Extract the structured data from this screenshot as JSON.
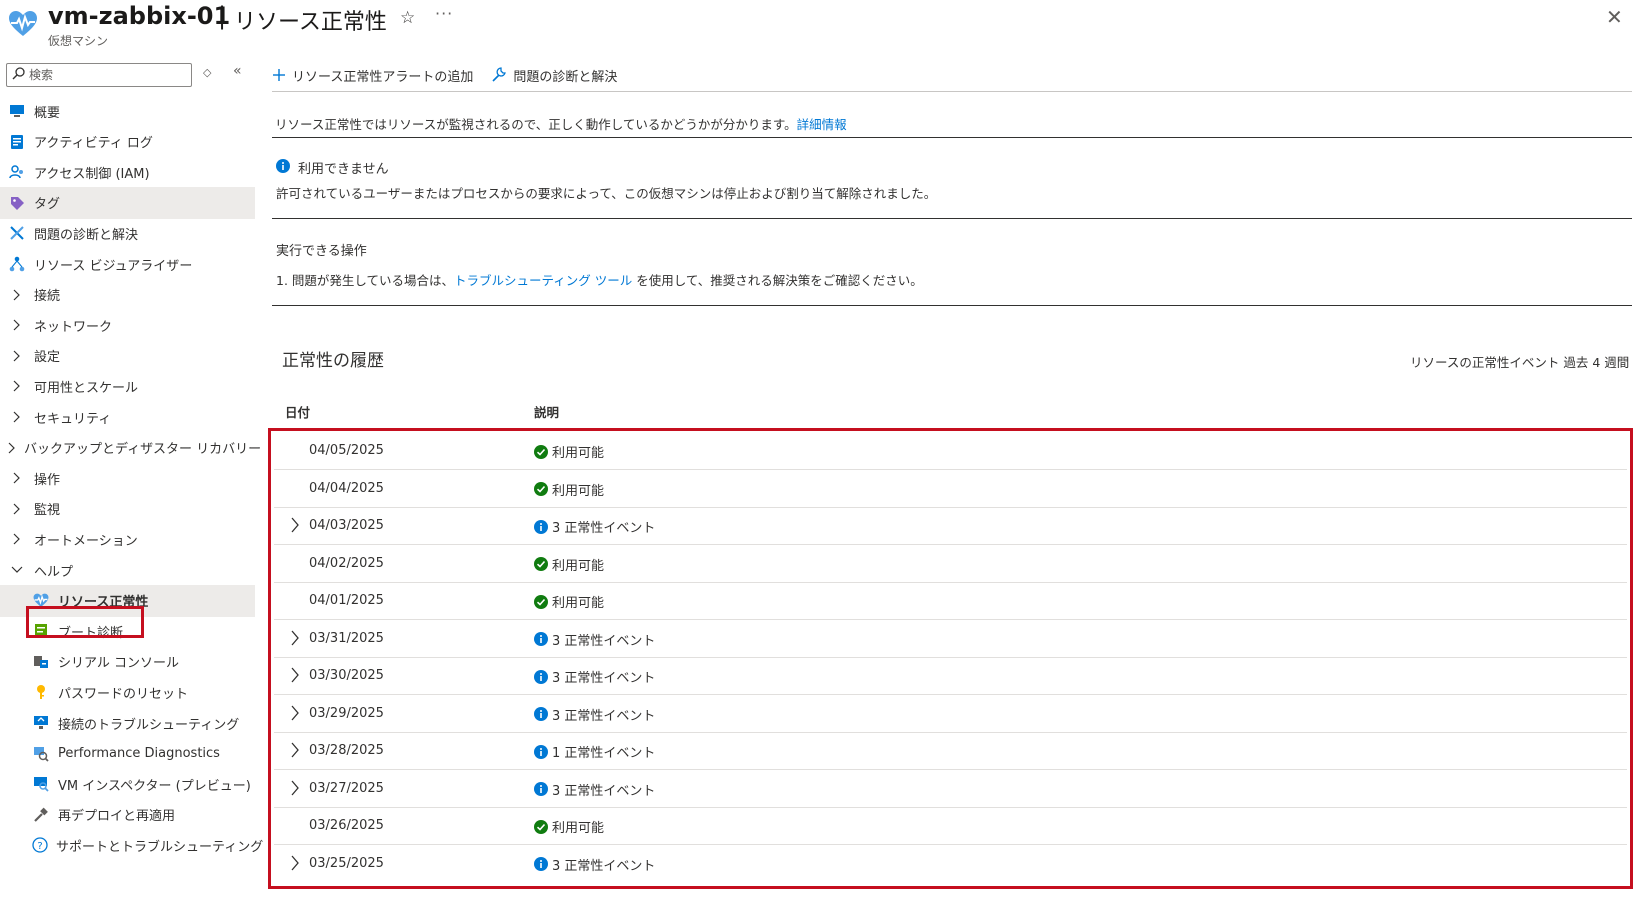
{
  "header": {
    "title": "vm-zabbix-01",
    "separator": "|",
    "page": "リソース正常性",
    "subtitle": "仮想マシン",
    "star": "☆",
    "more": "···",
    "close": "✕"
  },
  "sidebar": {
    "search_placeholder": "検索",
    "sort_glyph": "◇",
    "collapse_glyph": "«",
    "items": [
      {
        "label": "概要",
        "icon": "overview-icon",
        "level": 0,
        "type": "icon"
      },
      {
        "label": "アクティビティ ログ",
        "icon": "activity-log-icon",
        "level": 0,
        "type": "icon"
      },
      {
        "label": "アクセス制御 (IAM)",
        "icon": "iam-icon",
        "level": 0,
        "type": "icon"
      },
      {
        "label": "タグ",
        "icon": "tag-icon",
        "level": 0,
        "type": "icon",
        "selected": true
      },
      {
        "label": "問題の診断と解決",
        "icon": "diagnose-icon",
        "level": 0,
        "type": "icon"
      },
      {
        "label": "リソース ビジュアライザー",
        "icon": "visualizer-icon",
        "level": 0,
        "type": "icon"
      },
      {
        "label": "接続",
        "level": 0,
        "type": "collapsed"
      },
      {
        "label": "ネットワーク",
        "level": 0,
        "type": "collapsed"
      },
      {
        "label": "設定",
        "level": 0,
        "type": "collapsed"
      },
      {
        "label": "可用性とスケール",
        "level": 0,
        "type": "collapsed"
      },
      {
        "label": "セキュリティ",
        "level": 0,
        "type": "collapsed"
      },
      {
        "label": "バックアップとディザスター リカバリー",
        "level": 0,
        "type": "collapsed"
      },
      {
        "label": "操作",
        "level": 0,
        "type": "collapsed"
      },
      {
        "label": "監視",
        "level": 0,
        "type": "collapsed"
      },
      {
        "label": "オートメーション",
        "level": 0,
        "type": "collapsed"
      },
      {
        "label": "ヘルプ",
        "level": 0,
        "type": "expanded"
      },
      {
        "label": "リソース正常性",
        "icon": "resource-health-icon",
        "level": 1,
        "type": "icon",
        "selected": true,
        "active": true
      },
      {
        "label": "ブート診断",
        "icon": "boot-diagnostics-icon",
        "level": 1,
        "type": "icon"
      },
      {
        "label": "シリアル コンソール",
        "icon": "serial-console-icon",
        "level": 1,
        "type": "icon"
      },
      {
        "label": "パスワードのリセット",
        "icon": "key-icon",
        "level": 1,
        "type": "icon"
      },
      {
        "label": "接続のトラブルシューティング",
        "icon": "connection-troubleshoot-icon",
        "level": 1,
        "type": "icon"
      },
      {
        "label": "Performance Diagnostics",
        "icon": "performance-diagnostics-icon",
        "level": 1,
        "type": "icon"
      },
      {
        "label": "VM インスペクター (プレビュー)",
        "icon": "vm-inspector-icon",
        "level": 1,
        "type": "icon"
      },
      {
        "label": "再デプロイと再適用",
        "icon": "redeploy-icon",
        "level": 1,
        "type": "icon"
      },
      {
        "label": "サポートとトラブルシューティング",
        "icon": "help-circle-icon",
        "level": 1,
        "type": "icon"
      }
    ]
  },
  "toolbar": {
    "add_alert": "リソース正常性アラートの追加",
    "diagnose": "問題の診断と解決"
  },
  "intro": {
    "text": "リソース正常性ではリソースが監視されるので、正しく動作しているかどうかが分かります。",
    "link": "詳細情報"
  },
  "status": {
    "title": "利用できません",
    "description": "許可されているユーザーまたはプロセスからの要求によって、この仮想マシンは停止および割り当て解除されました。"
  },
  "actions": {
    "title": "実行できる操作",
    "item_prefix": "1.  問題が発生している場合は、",
    "item_link": "トラブルシューティング ツール",
    "item_suffix": "を使用して、推奨される解決策をご確認ください。"
  },
  "history": {
    "title": "正常性の履歴",
    "range": "リソースの正常性イベント 過去 4 週間",
    "col_date": "日付",
    "col_desc": "説明",
    "rows": [
      {
        "date": "04/05/2025",
        "status": "ok",
        "text": "利用可能",
        "expandable": false
      },
      {
        "date": "04/04/2025",
        "status": "ok",
        "text": "利用可能",
        "expandable": false
      },
      {
        "date": "04/03/2025",
        "status": "info",
        "text": "3 正常性イベント",
        "expandable": true
      },
      {
        "date": "04/02/2025",
        "status": "ok",
        "text": "利用可能",
        "expandable": false
      },
      {
        "date": "04/01/2025",
        "status": "ok",
        "text": "利用可能",
        "expandable": false
      },
      {
        "date": "03/31/2025",
        "status": "info",
        "text": "3 正常性イベント",
        "expandable": true
      },
      {
        "date": "03/30/2025",
        "status": "info",
        "text": "3 正常性イベント",
        "expandable": true
      },
      {
        "date": "03/29/2025",
        "status": "info",
        "text": "3 正常性イベント",
        "expandable": true
      },
      {
        "date": "03/28/2025",
        "status": "info",
        "text": "1 正常性イベント",
        "expandable": true
      },
      {
        "date": "03/27/2025",
        "status": "info",
        "text": "3 正常性イベント",
        "expandable": true
      },
      {
        "date": "03/26/2025",
        "status": "ok",
        "text": "利用可能",
        "expandable": false
      },
      {
        "date": "03/25/2025",
        "status": "info",
        "text": "3 正常性イベント",
        "expandable": true
      }
    ]
  },
  "colors": {
    "accent": "#0078d4",
    "ok": "#107c10",
    "info": "#0078d4",
    "highlight": "#c50f1f"
  }
}
